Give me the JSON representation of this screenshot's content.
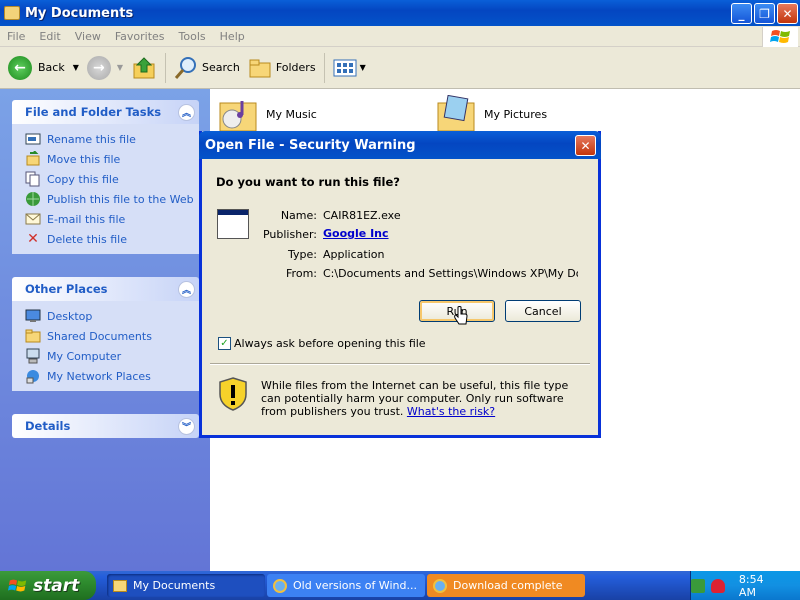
{
  "window": {
    "title": "My Documents"
  },
  "menu": [
    "File",
    "Edit",
    "View",
    "Favorites",
    "Tools",
    "Help"
  ],
  "toolbar": {
    "back": "Back",
    "search": "Search",
    "folders": "Folders"
  },
  "panels": {
    "file_tasks": {
      "title": "File and Folder Tasks",
      "items": [
        "Rename this file",
        "Move this file",
        "Copy this file",
        "Publish this file to the Web",
        "E-mail this file",
        "Delete this file"
      ]
    },
    "other_places": {
      "title": "Other Places",
      "items": [
        "Desktop",
        "Shared Documents",
        "My Computer",
        "My Network Places"
      ]
    },
    "details": {
      "title": "Details"
    }
  },
  "folders": {
    "music": "My Music",
    "pictures": "My Pictures"
  },
  "dialog": {
    "title": "Open File - Security Warning",
    "question": "Do you want to run this file?",
    "labels": {
      "name": "Name:",
      "publisher": "Publisher:",
      "type": "Type:",
      "from": "From:"
    },
    "values": {
      "name": "CAIR81EZ.exe",
      "publisher": "Google Inc",
      "type": "Application",
      "from": "C:\\Documents and Settings\\Windows XP\\My Docu..."
    },
    "run_button": "Run",
    "cancel_button": "Cancel",
    "checkbox": "Always ask before opening this file",
    "warning_text": "While files from the Internet can be useful, this file type can potentially harm your computer. Only run software from publishers you trust.",
    "risk_link": "What's the risk?"
  },
  "taskbar": {
    "start": "start",
    "tasks": [
      "My Documents",
      "Old versions of Wind...",
      "Download complete"
    ],
    "clock": "8:54 AM"
  }
}
